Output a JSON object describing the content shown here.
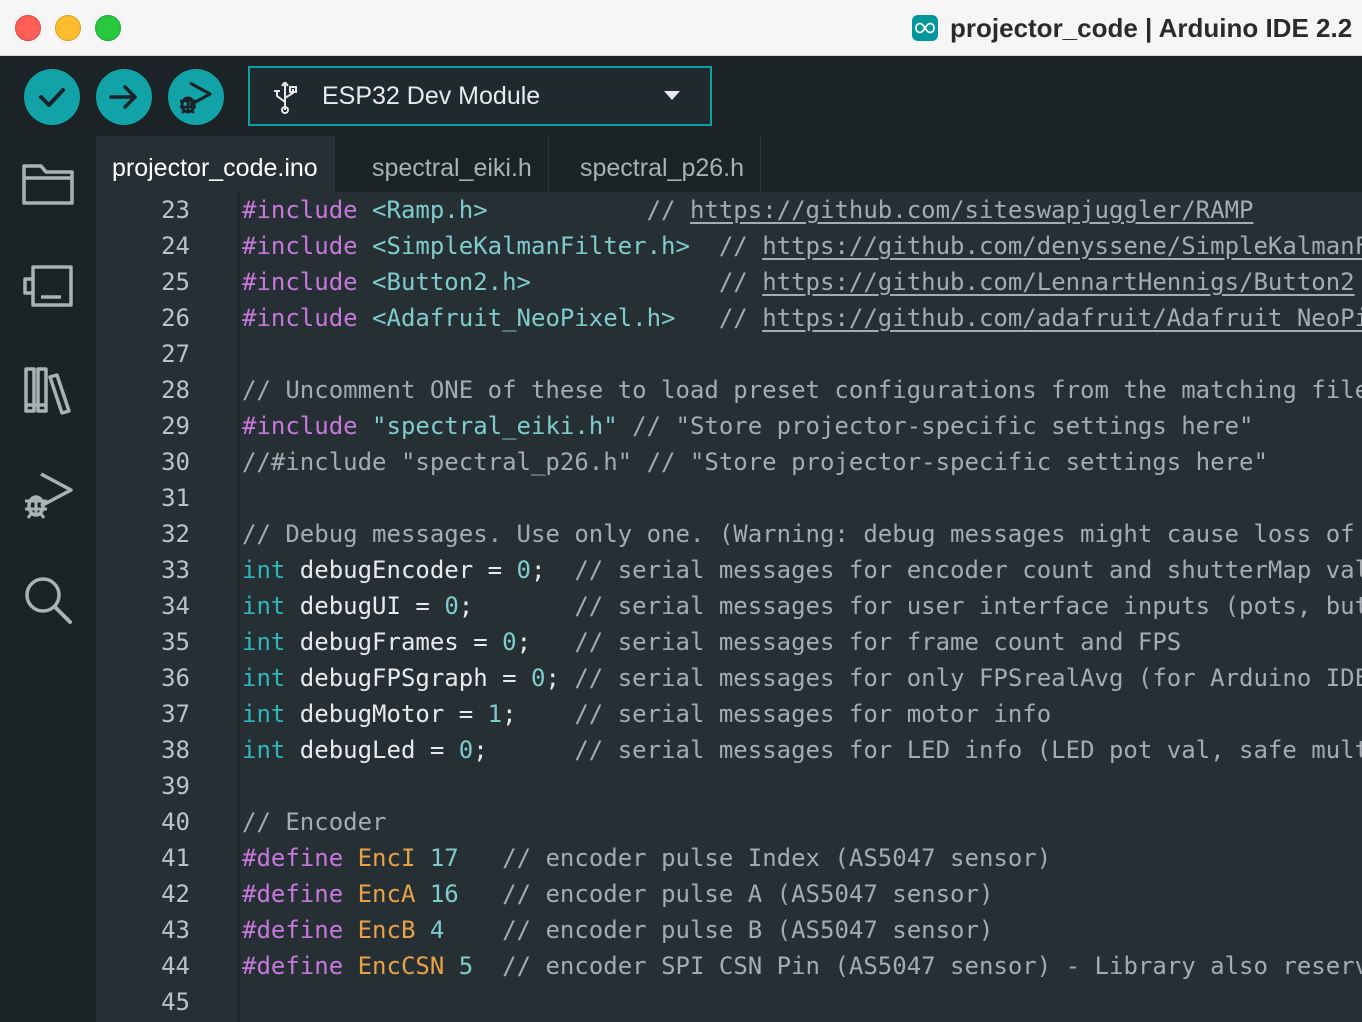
{
  "window": {
    "title": "projector_code | Arduino IDE 2.2",
    "app_icon": "arduino-infinity-icon"
  },
  "colors": {
    "accent": "#11a3a8",
    "background": "#1b2327",
    "editor_background": "#263034",
    "preprocessor": "#c678dd",
    "type_keyword": "#2fb6ba",
    "string_number": "#7fcbcd",
    "define_name": "#e9a146",
    "comment": "#a5abae"
  },
  "toolbar": {
    "verify_icon": "check-icon",
    "upload_icon": "arrow-right-icon",
    "debug_icon": "debug-icon",
    "board": {
      "label": "ESP32 Dev Module",
      "icon": "usb-icon"
    }
  },
  "sidebar": {
    "items": [
      {
        "name": "sketchbook",
        "icon": "folder-icon"
      },
      {
        "name": "boards-manager",
        "icon": "board-icon"
      },
      {
        "name": "library-manager",
        "icon": "library-icon"
      },
      {
        "name": "debug",
        "icon": "debug-icon"
      },
      {
        "name": "search",
        "icon": "search-icon"
      }
    ]
  },
  "tabs": [
    {
      "label": "projector_code.ino",
      "active": true
    },
    {
      "label": "spectral_eiki.h",
      "active": false
    },
    {
      "label": "spectral_p26.h",
      "active": false
    }
  ],
  "editor": {
    "lines": [
      {
        "n": "23",
        "tokens": [
          [
            "kw",
            "#include"
          ],
          [
            "t",
            " "
          ],
          [
            "str",
            "<Ramp.h>"
          ],
          [
            "t",
            "           "
          ],
          [
            "cm",
            "// "
          ],
          [
            "url",
            "https://github.com/siteswapjuggler/RAMP"
          ]
        ]
      },
      {
        "n": "24",
        "tokens": [
          [
            "kw",
            "#include"
          ],
          [
            "t",
            " "
          ],
          [
            "str",
            "<SimpleKalmanFilter.h>"
          ],
          [
            "t",
            "  "
          ],
          [
            "cm",
            "// "
          ],
          [
            "url",
            "https://github.com/denyssene/SimpleKalmanFilter"
          ]
        ]
      },
      {
        "n": "25",
        "tokens": [
          [
            "kw",
            "#include"
          ],
          [
            "t",
            " "
          ],
          [
            "str",
            "<Button2.h>"
          ],
          [
            "t",
            "             "
          ],
          [
            "cm",
            "// "
          ],
          [
            "url",
            "https://github.com/LennartHennigs/Button2"
          ]
        ]
      },
      {
        "n": "26",
        "tokens": [
          [
            "kw",
            "#include"
          ],
          [
            "t",
            " "
          ],
          [
            "str",
            "<Adafruit_NeoPixel.h>"
          ],
          [
            "t",
            "   "
          ],
          [
            "cm",
            "// "
          ],
          [
            "url",
            "https://github.com/adafruit/Adafruit_NeoPixel"
          ]
        ]
      },
      {
        "n": "27",
        "tokens": []
      },
      {
        "n": "28",
        "tokens": [
          [
            "cm",
            "// Uncomment ONE of these to load preset configurations from the matching file"
          ]
        ]
      },
      {
        "n": "29",
        "tokens": [
          [
            "kw",
            "#include"
          ],
          [
            "t",
            " "
          ],
          [
            "str",
            "\"spectral_eiki.h\""
          ],
          [
            "t",
            " "
          ],
          [
            "cm",
            "// \"Store projector-specific settings here\""
          ]
        ]
      },
      {
        "n": "30",
        "tokens": [
          [
            "cm",
            "//#include \"spectral_p26.h\" // \"Store projector-specific settings here\""
          ]
        ]
      },
      {
        "n": "31",
        "tokens": []
      },
      {
        "n": "32",
        "tokens": [
          [
            "cm",
            "// Debug messages. Use only one. (Warning: debug messages might cause loss of"
          ]
        ]
      },
      {
        "n": "33",
        "tokens": [
          [
            "ty",
            "int"
          ],
          [
            "t",
            " debugEncoder = "
          ],
          [
            "num",
            "0"
          ],
          [
            "t",
            ";  "
          ],
          [
            "cm",
            "// serial messages for encoder count and shutterMap value"
          ]
        ]
      },
      {
        "n": "34",
        "tokens": [
          [
            "ty",
            "int"
          ],
          [
            "t",
            " debugUI = "
          ],
          [
            "num",
            "0"
          ],
          [
            "t",
            ";       "
          ],
          [
            "cm",
            "// serial messages for user interface inputs (pots, buttons)"
          ]
        ]
      },
      {
        "n": "35",
        "tokens": [
          [
            "ty",
            "int"
          ],
          [
            "t",
            " debugFrames = "
          ],
          [
            "num",
            "0"
          ],
          [
            "t",
            ";   "
          ],
          [
            "cm",
            "// serial messages for frame count and FPS"
          ]
        ]
      },
      {
        "n": "36",
        "tokens": [
          [
            "ty",
            "int"
          ],
          [
            "t",
            " debugFPSgraph = "
          ],
          [
            "num",
            "0"
          ],
          [
            "t",
            "; "
          ],
          [
            "cm",
            "// serial messages for only FPSrealAvg (for Arduino IDE"
          ]
        ]
      },
      {
        "n": "37",
        "tokens": [
          [
            "ty",
            "int"
          ],
          [
            "t",
            " debugMotor = "
          ],
          [
            "num",
            "1"
          ],
          [
            "t",
            ";    "
          ],
          [
            "cm",
            "// serial messages for motor info"
          ]
        ]
      },
      {
        "n": "38",
        "tokens": [
          [
            "ty",
            "int"
          ],
          [
            "t",
            " debugLed = "
          ],
          [
            "num",
            "0"
          ],
          [
            "t",
            ";      "
          ],
          [
            "cm",
            "// serial messages for LED info (LED pot val, safe mult"
          ]
        ]
      },
      {
        "n": "39",
        "tokens": []
      },
      {
        "n": "40",
        "tokens": [
          [
            "cm",
            "// Encoder"
          ]
        ]
      },
      {
        "n": "41",
        "tokens": [
          [
            "kw",
            "#define"
          ],
          [
            "t",
            " "
          ],
          [
            "def",
            "EncI"
          ],
          [
            "t",
            " "
          ],
          [
            "num",
            "17"
          ],
          [
            "t",
            "   "
          ],
          [
            "cm",
            "// encoder pulse Index (AS5047 sensor)"
          ]
        ]
      },
      {
        "n": "42",
        "tokens": [
          [
            "kw",
            "#define"
          ],
          [
            "t",
            " "
          ],
          [
            "def",
            "EncA"
          ],
          [
            "t",
            " "
          ],
          [
            "num",
            "16"
          ],
          [
            "t",
            "   "
          ],
          [
            "cm",
            "// encoder pulse A (AS5047 sensor)"
          ]
        ]
      },
      {
        "n": "43",
        "tokens": [
          [
            "kw",
            "#define"
          ],
          [
            "t",
            " "
          ],
          [
            "def",
            "EncB"
          ],
          [
            "t",
            " "
          ],
          [
            "num",
            "4"
          ],
          [
            "t",
            "    "
          ],
          [
            "cm",
            "// encoder pulse B (AS5047 sensor)"
          ]
        ]
      },
      {
        "n": "44",
        "tokens": [
          [
            "kw",
            "#define"
          ],
          [
            "t",
            " "
          ],
          [
            "def",
            "EncCSN"
          ],
          [
            "t",
            " "
          ],
          [
            "num",
            "5"
          ],
          [
            "t",
            "  "
          ],
          [
            "cm",
            "// encoder SPI CSN Pin (AS5047 sensor) - Library also reserv"
          ]
        ]
      },
      {
        "n": "45",
        "tokens": []
      }
    ]
  }
}
